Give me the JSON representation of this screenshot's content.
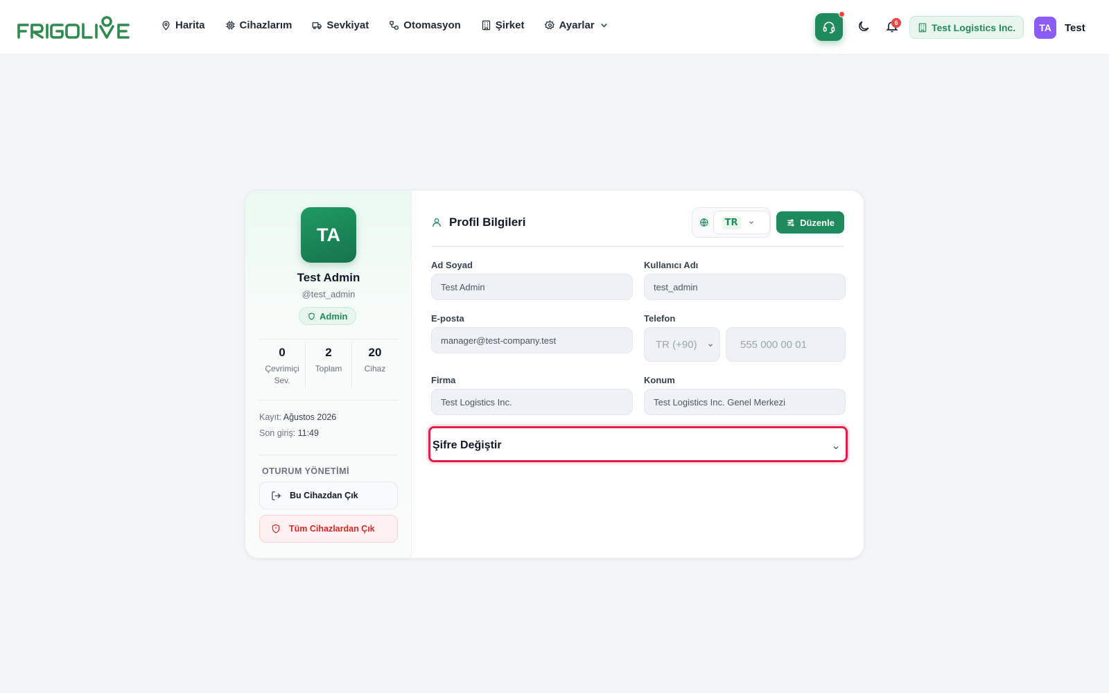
{
  "brand": {
    "logo_text": "FRIGOLIVE",
    "accent": "#1f8a5c"
  },
  "nav": {
    "items": [
      {
        "label": "Harita",
        "icon": "map-pin-icon"
      },
      {
        "label": "Cihazlarım",
        "icon": "chip-icon"
      },
      {
        "label": "Sevkiyat",
        "icon": "truck-icon"
      },
      {
        "label": "Otomasyon",
        "icon": "workflow-icon"
      },
      {
        "label": "Şirket",
        "icon": "building-icon"
      },
      {
        "label": "Ayarlar",
        "icon": "gear-icon"
      }
    ]
  },
  "header": {
    "notifications_count": "6",
    "company": "Test Logistics Inc.",
    "user_initials": "TA",
    "user_name": "Test"
  },
  "profile": {
    "initials": "TA",
    "full_name": "Test Admin",
    "username": "@test_admin",
    "role": "Admin",
    "stats": [
      {
        "value": "0",
        "label": "Çevrimiçi Sev."
      },
      {
        "value": "2",
        "label": "Toplam"
      },
      {
        "value": "20",
        "label": "Cihaz"
      }
    ],
    "registered_label": "Kayıt:",
    "registered_value": "Ağustos 2026",
    "last_login_label": "Son giriş:",
    "last_login_value": "11:49",
    "session_title": "OTURUM YÖNETİMİ",
    "logout_this": "Bu Cihazdan Çık",
    "logout_all": "Tüm Cihazlardan Çık"
  },
  "form": {
    "title": "Profil Bilgileri",
    "language": "TR",
    "edit_label": "Düzenle",
    "name_label": "Ad Soyad",
    "name_value": "Test Admin",
    "username_label": "Kullanıcı Adı",
    "username_value": "test_admin",
    "email_label": "E-posta",
    "email_value": "manager@test-company.test",
    "phone_label": "Telefon",
    "phone_country": "TR (+90)",
    "phone_placeholder": "555 000 00 01",
    "company_label": "Firma",
    "company_value": "Test Logistics Inc.",
    "location_label": "Konum",
    "location_value": "Test Logistics Inc. Genel Merkezi",
    "password_section": "Şifre Değiştir"
  }
}
